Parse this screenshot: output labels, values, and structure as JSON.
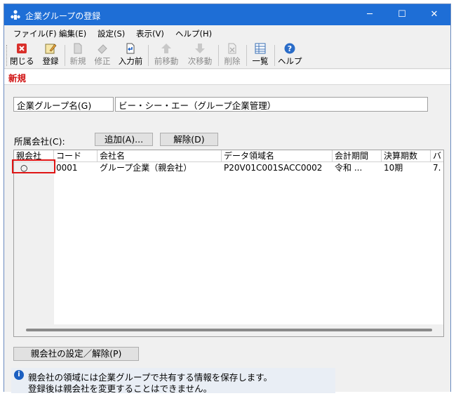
{
  "window": {
    "title": "企業グループの登録",
    "minimize": "─",
    "maximize": "☐",
    "close": "✕"
  },
  "menu": [
    "ファイル(F)",
    "編集(E)",
    "設定(S)",
    "表示(V)",
    "ヘルプ(H)"
  ],
  "toolbar": {
    "close": "閉じる",
    "register": "登録",
    "new": "新規",
    "edit": "修正",
    "prev_input": "入力前",
    "prev_move": "前移動",
    "next_move": "次移動",
    "delete": "削除",
    "list": "一覧",
    "help": "ヘルプ"
  },
  "tab": "新規",
  "form": {
    "group_name_label": "企業グループ名(G)",
    "group_name_value": "ビー・シー・エー（グループ企業管理）",
    "member_label": "所属会社(C):",
    "add_button": "追加(A)...",
    "remove_button": "解除(D)",
    "parent_button": "親会社の設定／解除(P)"
  },
  "grid": {
    "columns": [
      "親会社",
      "コード",
      "会社名",
      "データ領域名",
      "会計期間",
      "決算期数",
      "バ"
    ],
    "rows": [
      {
        "parent": "○",
        "code": "0001",
        "name": "グループ企業（親会社）",
        "data_area": "P20V01C001SACC0002",
        "period": "令和 ...",
        "term": "10期",
        "ver": "7."
      }
    ]
  },
  "info": {
    "line1": "親会社の領域には企業グループで共有する情報を保存します。",
    "line2": "登録後は親会社を変更することはできません。"
  },
  "colors": {
    "titlebar": "#1e6ed6",
    "tab_text": "#d01010",
    "highlight": "#e01515"
  }
}
